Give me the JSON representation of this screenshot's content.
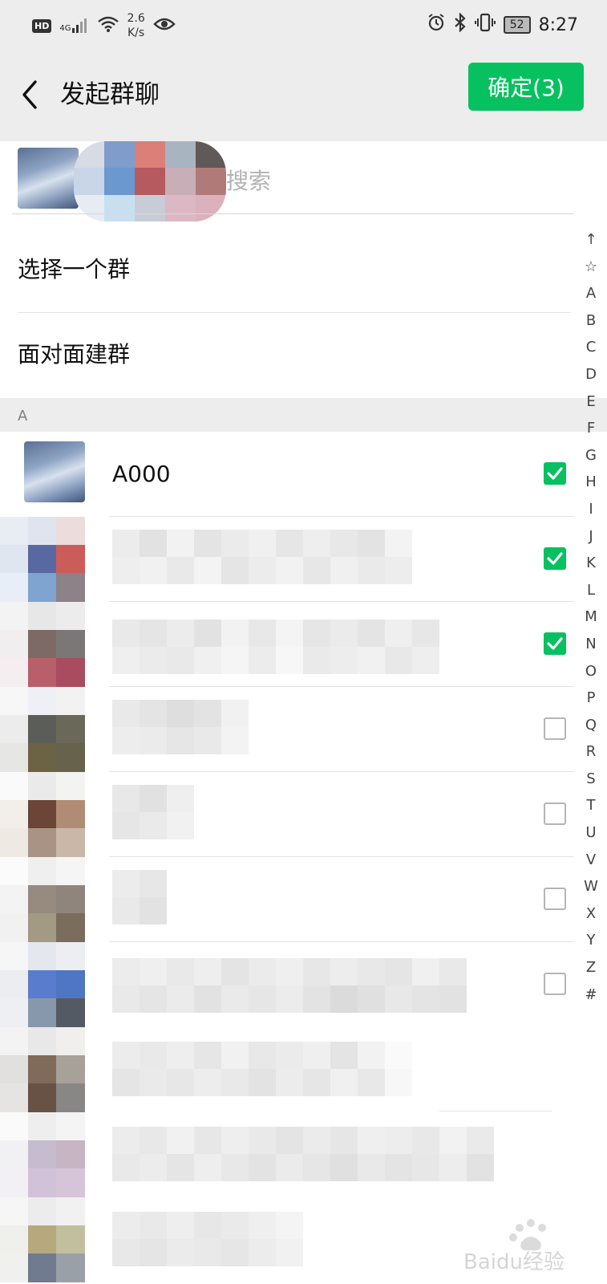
{
  "status": {
    "hd": "HD",
    "net": "4G",
    "speed_top": "2.6",
    "speed_bottom": "K/s",
    "battery": "52",
    "time": "8:27"
  },
  "nav": {
    "title": "发起群聊",
    "confirm_label": "确定(3)"
  },
  "search": {
    "placeholder": "搜索"
  },
  "actions": [
    {
      "label": "选择一个群"
    },
    {
      "label": "面对面建群"
    }
  ],
  "section": {
    "letter": "A"
  },
  "contacts": [
    {
      "name": "A000",
      "checked": true
    },
    {
      "name": "",
      "checked": true
    },
    {
      "name": "",
      "checked": true
    },
    {
      "name": "",
      "checked": false
    },
    {
      "name": "",
      "checked": false
    },
    {
      "name": "",
      "checked": false
    },
    {
      "name": "",
      "checked": false
    }
  ],
  "alphabet": [
    "↑",
    "☆",
    "A",
    "B",
    "C",
    "D",
    "E",
    "F",
    "G",
    "H",
    "I",
    "J",
    "K",
    "L",
    "M",
    "N",
    "O",
    "P",
    "Q",
    "R",
    "S",
    "T",
    "U",
    "V",
    "W",
    "X",
    "Y",
    "Z",
    "#"
  ],
  "watermark": "Baidu经验"
}
